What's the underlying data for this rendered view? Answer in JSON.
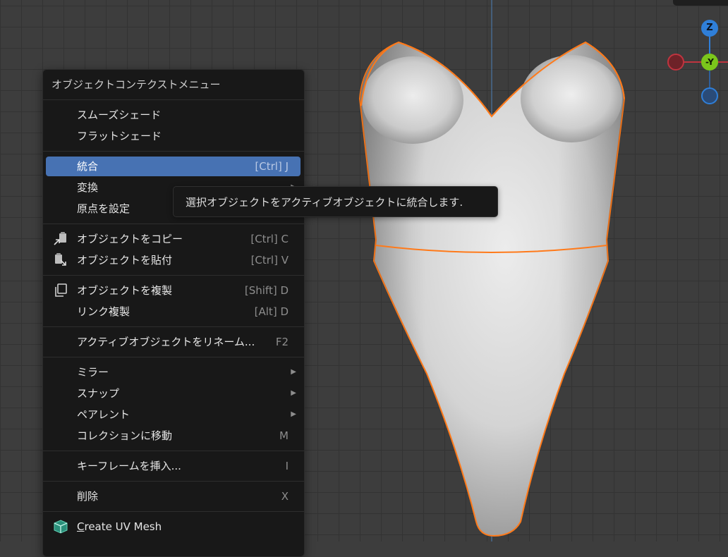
{
  "menu": {
    "title": "オブジェクトコンテクストメニュー",
    "items": [
      {
        "label": "スムーズシェード"
      },
      {
        "label": "フラットシェード"
      },
      {
        "label": "統合",
        "shortcut": "[Ctrl] J"
      },
      {
        "label": "変換"
      },
      {
        "label": "原点を設定"
      },
      {
        "label": "オブジェクトをコピー",
        "shortcut": "[Ctrl] C",
        "icon": "copy-objects-icon"
      },
      {
        "label": "オブジェクトを貼付",
        "shortcut": "[Ctrl] V",
        "icon": "paste-objects-icon"
      },
      {
        "label": "オブジェクトを複製",
        "shortcut": "[Shift] D",
        "icon": "duplicate-icon"
      },
      {
        "label": "リンク複製",
        "shortcut": "[Alt] D"
      },
      {
        "label": "アクティブオブジェクトをリネーム...",
        "shortcut": "F2"
      },
      {
        "label": "ミラー"
      },
      {
        "label": "スナップ"
      },
      {
        "label": "ペアレント"
      },
      {
        "label": "コレクションに移動",
        "shortcut": "M"
      },
      {
        "label": "キーフレームを挿入...",
        "shortcut": "I"
      },
      {
        "label": "削除",
        "shortcut": "X"
      },
      {
        "label_first": "C",
        "label_rest": "reate UV Mesh",
        "icon": "uv-mesh-icon"
      }
    ]
  },
  "tooltip": {
    "text": "選択オブジェクトをアクティブオブジェクトに統合します."
  },
  "gizmo": {
    "z_label": "Z",
    "neg_y_label": "-Y",
    "colors": {
      "z": "#2f7fd9",
      "y": "#7bc61b",
      "x": "#c0343f"
    }
  },
  "colors": {
    "accent": "#4772b3",
    "selection_outline": "#ff7a1a",
    "viewport_bg": "#3d3d3d"
  }
}
